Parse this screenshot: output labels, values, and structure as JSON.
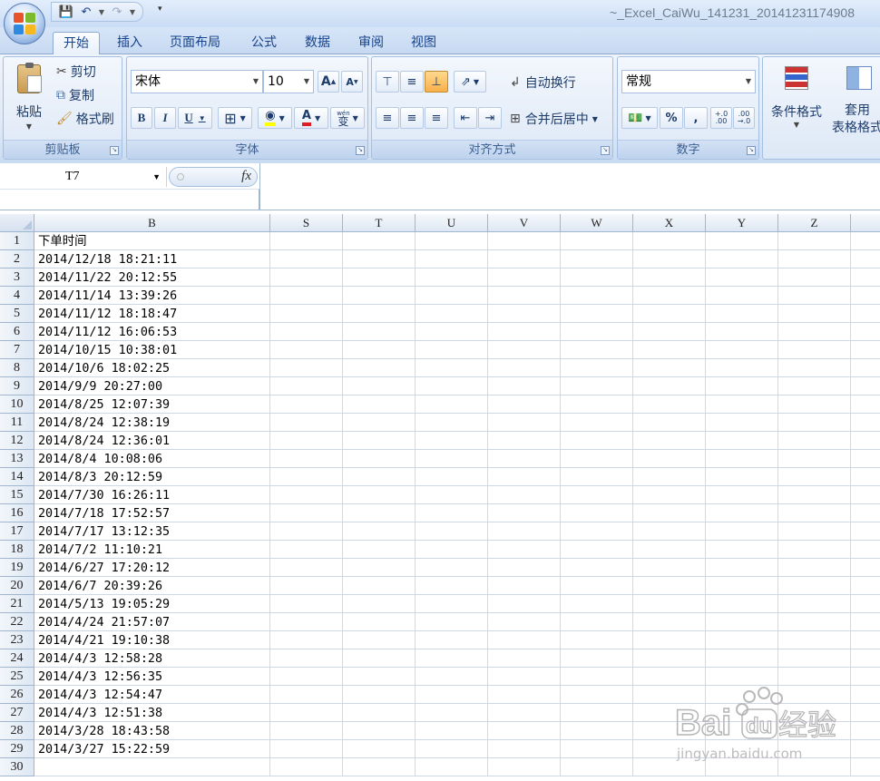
{
  "window": {
    "title": "~_Excel_CaiWu_141231_20141231174908"
  },
  "qat": {
    "save_icon": "save-icon",
    "undo_icon": "undo-icon",
    "redo_icon": "redo-icon"
  },
  "tabs": [
    {
      "label": "开始",
      "active": true
    },
    {
      "label": "插入",
      "active": false
    },
    {
      "label": "页面布局",
      "active": false
    },
    {
      "label": "公式",
      "active": false
    },
    {
      "label": "数据",
      "active": false
    },
    {
      "label": "审阅",
      "active": false
    },
    {
      "label": "视图",
      "active": false
    }
  ],
  "clipboard": {
    "group_label": "剪贴板",
    "paste": "粘贴",
    "cut": "剪切",
    "copy": "复制",
    "format_painter": "格式刷"
  },
  "font": {
    "group_label": "字体",
    "name": "宋体",
    "size": "10",
    "grow": "A",
    "shrink": "A",
    "bold": "B",
    "italic": "I",
    "underline": "U",
    "phonetic": "wén",
    "phonetic_char": "变"
  },
  "alignment": {
    "group_label": "对齐方式",
    "wrap_text": "自动换行",
    "merge_center": "合并后居中"
  },
  "number": {
    "group_label": "数字",
    "format": "常规",
    "percent": "%",
    "comma": ",",
    "inc_decimal": "+.0\n.00",
    "dec_decimal": ".00\n→.0"
  },
  "styles": {
    "conditional_formatting": "条件格式",
    "format_as_table": "套用\n表格格式"
  },
  "formula_bar": {
    "name_box": "T7",
    "fx_label": "fx",
    "content": ""
  },
  "sheet": {
    "columns": [
      "B",
      "S",
      "T",
      "U",
      "V",
      "W",
      "X",
      "Y",
      "Z"
    ],
    "rows": [
      {
        "num": "1",
        "b": "下单时间"
      },
      {
        "num": "2",
        "b": "2014/12/18 18:21:11"
      },
      {
        "num": "3",
        "b": "2014/11/22 20:12:55"
      },
      {
        "num": "4",
        "b": "2014/11/14 13:39:26"
      },
      {
        "num": "5",
        "b": "2014/11/12 18:18:47"
      },
      {
        "num": "6",
        "b": "2014/11/12 16:06:53"
      },
      {
        "num": "7",
        "b": "2014/10/15 10:38:01"
      },
      {
        "num": "8",
        "b": "2014/10/6 18:02:25"
      },
      {
        "num": "9",
        "b": "2014/9/9 20:27:00"
      },
      {
        "num": "10",
        "b": "2014/8/25 12:07:39"
      },
      {
        "num": "11",
        "b": "2014/8/24 12:38:19"
      },
      {
        "num": "12",
        "b": "2014/8/24 12:36:01"
      },
      {
        "num": "13",
        "b": "2014/8/4 10:08:06"
      },
      {
        "num": "14",
        "b": "2014/8/3 20:12:59"
      },
      {
        "num": "15",
        "b": "2014/7/30 16:26:11"
      },
      {
        "num": "16",
        "b": "2014/7/18 17:52:57"
      },
      {
        "num": "17",
        "b": "2014/7/17 13:12:35"
      },
      {
        "num": "18",
        "b": "2014/7/2 11:10:21"
      },
      {
        "num": "19",
        "b": "2014/6/27 17:20:12"
      },
      {
        "num": "20",
        "b": "2014/6/7 20:39:26"
      },
      {
        "num": "21",
        "b": "2014/5/13 19:05:29"
      },
      {
        "num": "22",
        "b": "2014/4/24 21:57:07"
      },
      {
        "num": "23",
        "b": "2014/4/21 19:10:38"
      },
      {
        "num": "24",
        "b": "2014/4/3 12:58:28"
      },
      {
        "num": "25",
        "b": "2014/4/3 12:56:35"
      },
      {
        "num": "26",
        "b": "2014/4/3 12:54:47"
      },
      {
        "num": "27",
        "b": "2014/4/3 12:51:38"
      },
      {
        "num": "28",
        "b": "2014/3/28 18:43:58"
      },
      {
        "num": "29",
        "b": "2014/3/27 15:22:59"
      },
      {
        "num": "30",
        "b": ""
      }
    ]
  },
  "watermark": {
    "brand": "Bai",
    "brand2": "du",
    "name": "经验",
    "url": "jingyan.baidu.com"
  },
  "colors": {
    "accent": "#15428b",
    "header_bg": "#dde7f3",
    "grid": "#d0d7e5",
    "font_red": "#e02020",
    "highlight_yellow": "#ffff00"
  }
}
